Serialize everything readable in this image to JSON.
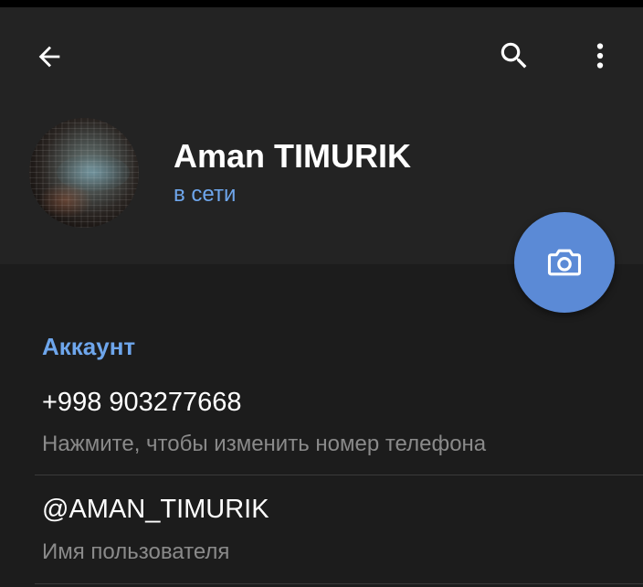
{
  "colors": {
    "header_background": "#232323",
    "page_background": "#1c1c1c",
    "accent_blue": "#6ea6ec",
    "fab_background": "#5b8ad6",
    "secondary_text": "#8a8a8a"
  },
  "toolbar": {
    "back_icon": "arrow-left-icon",
    "search_icon": "search-icon",
    "menu_icon": "more-vertical-icon"
  },
  "profile": {
    "name": "Aman TIMURIK",
    "status": "в сети",
    "avatar_icon": "profile-photo"
  },
  "fab": {
    "icon": "camera-icon"
  },
  "account": {
    "section_title": "Аккаунт",
    "phone": {
      "value": "+998 903277668",
      "hint": "Нажмите, чтобы изменить номер телефона"
    },
    "username": {
      "value": "@AMAN_TIMURIK",
      "hint": "Имя пользователя"
    }
  }
}
